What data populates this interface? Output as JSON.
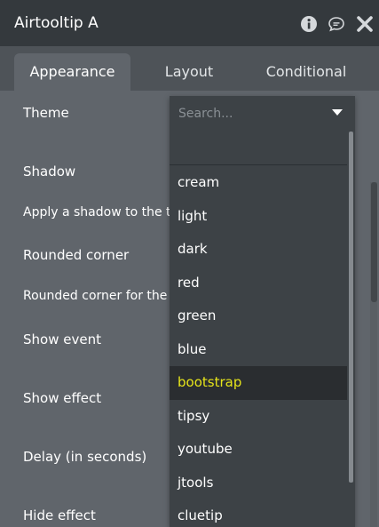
{
  "window": {
    "title": "Airtooltip A"
  },
  "tabs": [
    {
      "label": "Appearance",
      "active": true
    },
    {
      "label": "Layout",
      "active": false
    },
    {
      "label": "Conditional",
      "active": false
    }
  ],
  "properties": {
    "theme": "Theme",
    "shadow": "Shadow",
    "apply_shadow": "Apply a shadow to the toc",
    "rounded_corner": "Rounded corner",
    "rounded_corner_desc": "Rounded corner for the to",
    "show_event": "Show event",
    "show_effect": "Show effect",
    "delay": "Delay (in seconds)",
    "hide_effect": "Hide effect"
  },
  "dropdown": {
    "search_placeholder": "Search...",
    "options": [
      {
        "label": "cream",
        "selected": false
      },
      {
        "label": "light",
        "selected": false
      },
      {
        "label": "dark",
        "selected": false
      },
      {
        "label": "red",
        "selected": false
      },
      {
        "label": "green",
        "selected": false
      },
      {
        "label": "blue",
        "selected": false
      },
      {
        "label": "bootstrap",
        "selected": true
      },
      {
        "label": "tipsy",
        "selected": false
      },
      {
        "label": "youtube",
        "selected": false
      },
      {
        "label": "jtools",
        "selected": false
      },
      {
        "label": "cluetip",
        "selected": false
      }
    ]
  },
  "colors": {
    "panel_bg": "#60656b",
    "titlebar_bg": "#34393d",
    "dropdown_bg": "#3d4246",
    "highlight_bg": "#2a2d30",
    "highlight_text": "#e6e41a"
  },
  "icons": [
    "info-icon",
    "comment-icon",
    "close-icon",
    "caret-down-icon"
  ]
}
